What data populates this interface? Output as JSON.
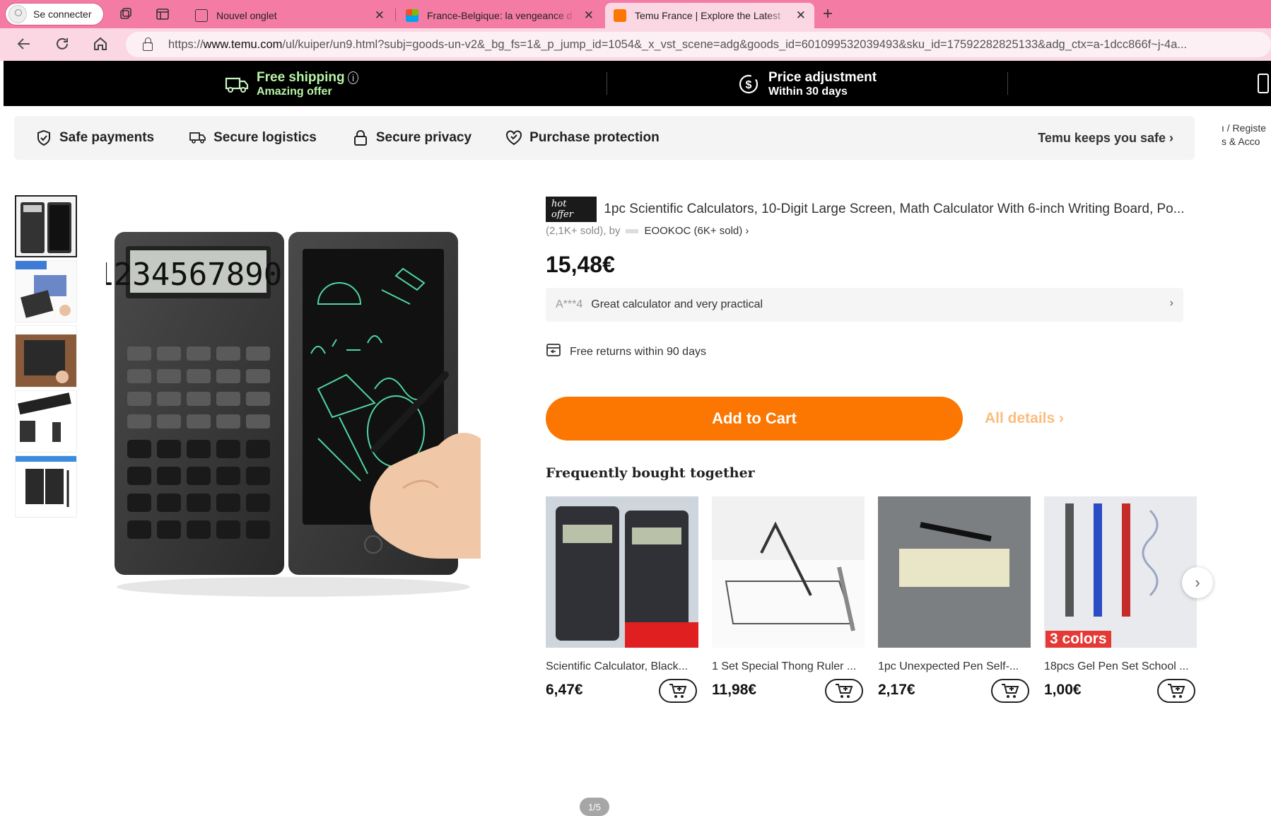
{
  "browser": {
    "profile_label": "Se connecter",
    "tabs": [
      {
        "label": "Nouvel onglet"
      },
      {
        "label": "France-Belgique: la vengeance d"
      },
      {
        "label": "Temu France | Explore the Latest"
      }
    ],
    "url_prefix": "https://",
    "url_host": "www.temu.com",
    "url_rest": "/ul/kuiper/un9.html?subj=goods-un-v2&_bg_fs=1&_p_jump_id=1054&_x_vst_scene=adg&goods_id=601099532039493&sku_id=17592282825133&adg_ctx=a-1dcc866f~j-4a..."
  },
  "promo": {
    "shipping_title": "Free shipping",
    "shipping_sub": "Amazing offer",
    "price_title": "Price adjustment",
    "price_sub": "Within 30 days"
  },
  "safety": {
    "items": [
      {
        "label": "Safe payments"
      },
      {
        "label": "Secure logistics"
      },
      {
        "label": "Secure privacy"
      },
      {
        "label": "Purchase protection"
      }
    ],
    "keeps_label": "Temu keeps you safe",
    "side_peek_1": "ı / Registe",
    "side_peek_2": "s & Acco"
  },
  "product": {
    "badge": "hot offer",
    "title": "1pc Scientific Calculators, 10-Digit Large Screen, Math Calculator With 6-inch Writing Board, Po...",
    "sold": "(2,1K+ sold), by",
    "store": "EOOKOC (6K+ sold)",
    "price": "15,48€",
    "review_user": "A***4",
    "review_text": "Great calculator and very practical",
    "returns": "Free returns within 90 days",
    "add_to_cart": "Add to Cart",
    "all_details": "All details",
    "image_pager": "1/5",
    "lcd_digits": "1234567890."
  },
  "fbt": {
    "title": "Frequently bought together",
    "items": [
      {
        "name": "Scientific Calculator, Black...",
        "price": "6,47€"
      },
      {
        "name": "1 Set Special Thong Ruler ...",
        "price": "11,98€"
      },
      {
        "name": "1pc Unexpected Pen Self-...",
        "price": "2,17€"
      },
      {
        "name": "18pcs Gel Pen Set School ...",
        "price": "1,00€",
        "badge": "3 colors"
      }
    ]
  },
  "colors": {
    "tab_bar": "#f37ba4",
    "address_bar": "#fbd7e4",
    "accent_orange": "#fb7701",
    "promo_green": "#b8f5a8"
  }
}
